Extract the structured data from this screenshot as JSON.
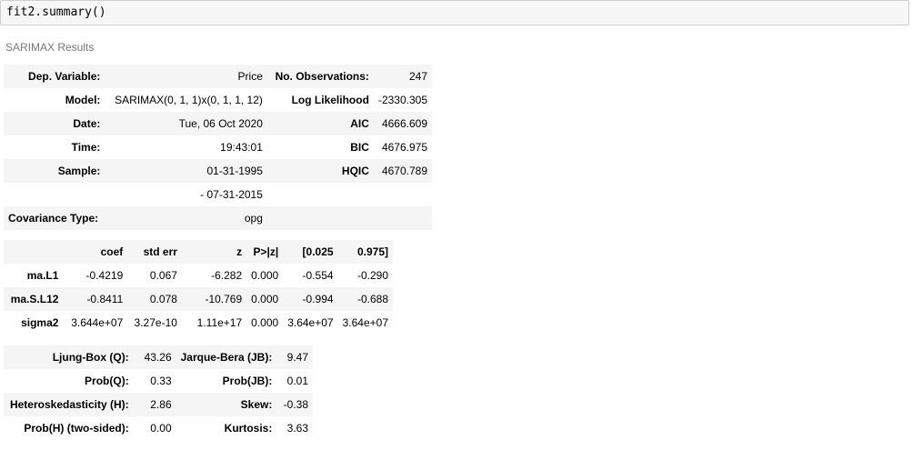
{
  "input_cell": {
    "code": "fit2.summary()"
  },
  "output": {
    "caption": "SARIMAX Results",
    "header_table": [
      [
        "Dep. Variable:",
        "Price",
        "No. Observations:",
        "247"
      ],
      [
        "Model:",
        "SARIMAX(0, 1, 1)x(0, 1, 1, 12)",
        "Log Likelihood",
        "-2330.305"
      ],
      [
        "Date:",
        "Tue, 06 Oct 2020",
        "AIC",
        "4666.609"
      ],
      [
        "Time:",
        "19:43:01",
        "BIC",
        "4676.975"
      ],
      [
        "Sample:",
        "01-31-1995",
        "HQIC",
        "4670.789"
      ],
      [
        "",
        "- 07-31-2015",
        "",
        ""
      ],
      [
        "Covariance Type:",
        "opg",
        "",
        ""
      ]
    ],
    "coef_table": {
      "headers": [
        "",
        "coef",
        "std err",
        "z",
        "P>|z|",
        "[0.025",
        "0.975]"
      ],
      "rows": [
        [
          "ma.L1",
          "-0.4219",
          "0.067",
          "-6.282",
          "0.000",
          "-0.554",
          "-0.290"
        ],
        [
          "ma.S.L12",
          "-0.8411",
          "0.078",
          "-10.769",
          "0.000",
          "-0.994",
          "-0.688"
        ],
        [
          "sigma2",
          "3.644e+07",
          "3.27e-10",
          "1.11e+17",
          "0.000",
          "3.64e+07",
          "3.64e+07"
        ]
      ]
    },
    "diag_table": [
      [
        "Ljung-Box (Q):",
        "43.26",
        "Jarque-Bera (JB):",
        "9.47"
      ],
      [
        "Prob(Q):",
        "0.33",
        "Prob(JB):",
        "0.01"
      ],
      [
        "Heteroskedasticity (H):",
        "2.86",
        "Skew:",
        "-0.38"
      ],
      [
        "Prob(H) (two-sided):",
        "0.00",
        "Kurtosis:",
        "3.63"
      ]
    ]
  }
}
